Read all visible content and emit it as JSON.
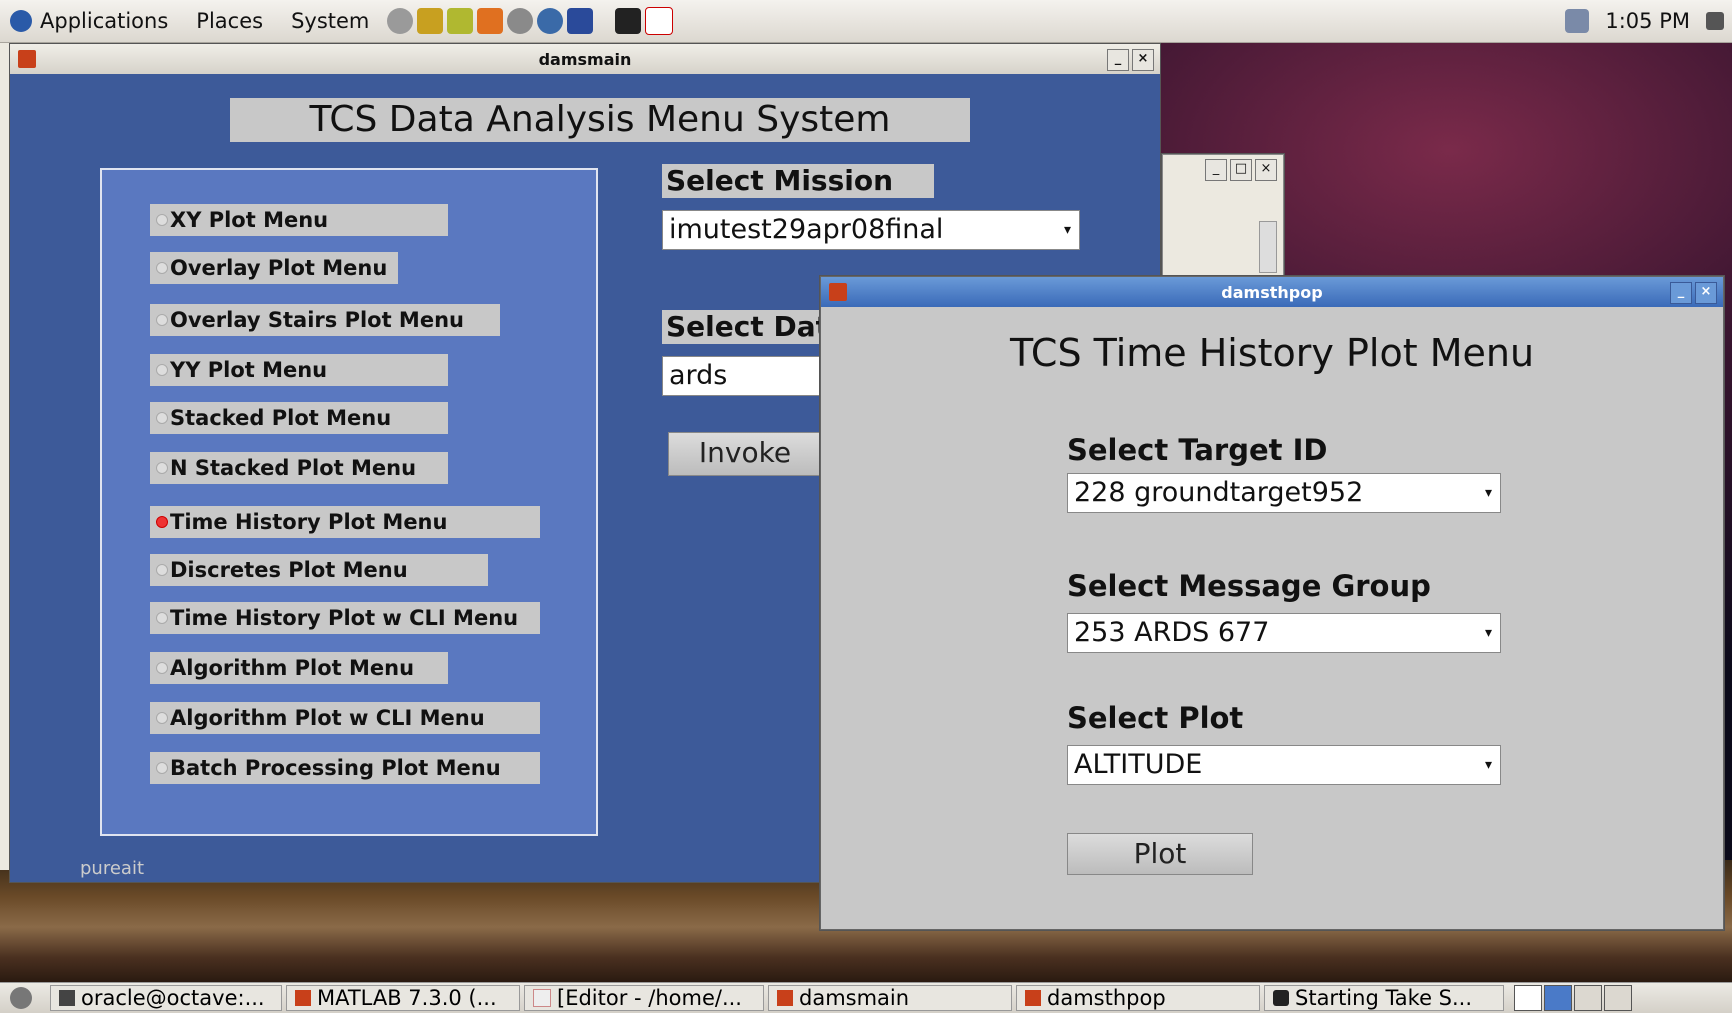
{
  "top_panel": {
    "menus": [
      "Applications",
      "Places",
      "System"
    ],
    "clock": "1:05 PM"
  },
  "damsmain": {
    "window_title": "damsmain",
    "heading": "TCS Data Analysis Menu System",
    "menu_options": [
      {
        "label": "XY Plot Menu",
        "selected": false
      },
      {
        "label": "Overlay Plot Menu",
        "selected": false
      },
      {
        "label": "Overlay Stairs Plot Menu",
        "selected": false
      },
      {
        "label": "YY Plot Menu",
        "selected": false
      },
      {
        "label": "Stacked Plot Menu",
        "selected": false
      },
      {
        "label": "N Stacked Plot Menu",
        "selected": false
      },
      {
        "label": "Time History Plot Menu",
        "selected": true
      },
      {
        "label": "Discretes Plot Menu",
        "selected": false
      },
      {
        "label": "Time History Plot w CLI Menu",
        "selected": false
      },
      {
        "label": "Algorithm Plot Menu",
        "selected": false
      },
      {
        "label": "Algorithm Plot w CLI Menu",
        "selected": false
      },
      {
        "label": "Batch Processing Plot Menu",
        "selected": false
      }
    ],
    "select_mission_label": "Select Mission",
    "mission_value": "imutest29apr08final",
    "select_data_label": "Select Dat",
    "data_value": "ards",
    "invoke_label": "Invoke",
    "background_text": "pureait"
  },
  "damsthpop": {
    "window_title": "damsthpop",
    "heading": "TCS Time History Plot Menu",
    "target_label": "Select Target ID",
    "target_value": "228 groundtarget952",
    "group_label": "Select Message Group",
    "group_value": "253 ARDS 677",
    "plot_label": "Select Plot",
    "plot_value": "ALTITUDE",
    "plot_button": "Plot"
  },
  "taskbar": [
    "oracle@octave:...",
    "MATLAB  7.3.0 (...",
    "[Editor - /home/...",
    "damsmain",
    "damsthpop",
    "Starting Take S..."
  ],
  "colors": {
    "main_bg": "#3d5a99",
    "panel_bg": "#5a78c0",
    "popup_bg": "#c8c8c8",
    "popup_titlebar": "#3a6ab8"
  }
}
